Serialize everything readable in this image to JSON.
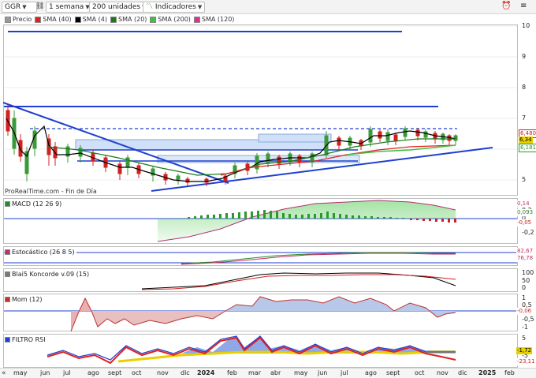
{
  "toolbar": {
    "symbol": "GGR",
    "interval": "1 semana",
    "units": "200 unidades",
    "indicators_label": "Indicadores"
  },
  "legend": [
    {
      "label": "Precio",
      "color": "#999999"
    },
    {
      "label": "SMA (40)",
      "color": "#e02020"
    },
    {
      "label": "SMA (4)",
      "color": "#000000"
    },
    {
      "label": "SMA (20)",
      "color": "#1a7a1a"
    },
    {
      "label": "SMA (200)",
      "color": "#40c040"
    },
    {
      "label": "SMA (120)",
      "color": "#e03090"
    }
  ],
  "watermark": "ProRealTime.com - Fin de Día",
  "price_axis": [
    "10",
    "9",
    "8",
    "7",
    "6",
    "5"
  ],
  "price_tags": {
    "upper": "6,480",
    "last": "6,34",
    "lower": "6,181"
  },
  "indicators": [
    {
      "label": "MACD (12 26 9)",
      "color": "#2a8a2a",
      "ticks": [
        "0,2",
        "0",
        "-0,2"
      ],
      "values": [
        "0,14",
        "0,093",
        "-0,05"
      ]
    },
    {
      "label": "Estocástico (26 8 5)",
      "color": "#c03060",
      "ticks": [],
      "values": [
        "82,67",
        "76,78"
      ]
    },
    {
      "label": "Blai5 Koncorde v.09 (15)",
      "color": "#777777",
      "ticks": [
        "100",
        "50",
        "0"
      ],
      "values": []
    },
    {
      "label": "Mom (12)",
      "color": "#c03030",
      "ticks": [
        "1",
        "0,5",
        "0",
        "-0,5",
        "-1"
      ],
      "values": [
        "-0,06"
      ]
    },
    {
      "label": "FILTRO RSI",
      "color": "#1f3fd0",
      "ticks": [
        "5",
        "-5"
      ],
      "values": [
        "-1,72",
        "-23,11"
      ]
    }
  ],
  "time_axis": [
    "may",
    "jun",
    "jul",
    "ago",
    "sept",
    "oct",
    "nov",
    "dic",
    "2024",
    "feb",
    "mar",
    "abr",
    "may",
    "jun",
    "jul",
    "ago",
    "sept",
    "oct",
    "nov",
    "dic",
    "2025",
    "feb"
  ],
  "colors": {
    "trend_line": "#1f3fd0",
    "up_candle": "#3a9a3a",
    "down_candle": "#d02020",
    "support_zone": "#cfe0f8"
  }
}
